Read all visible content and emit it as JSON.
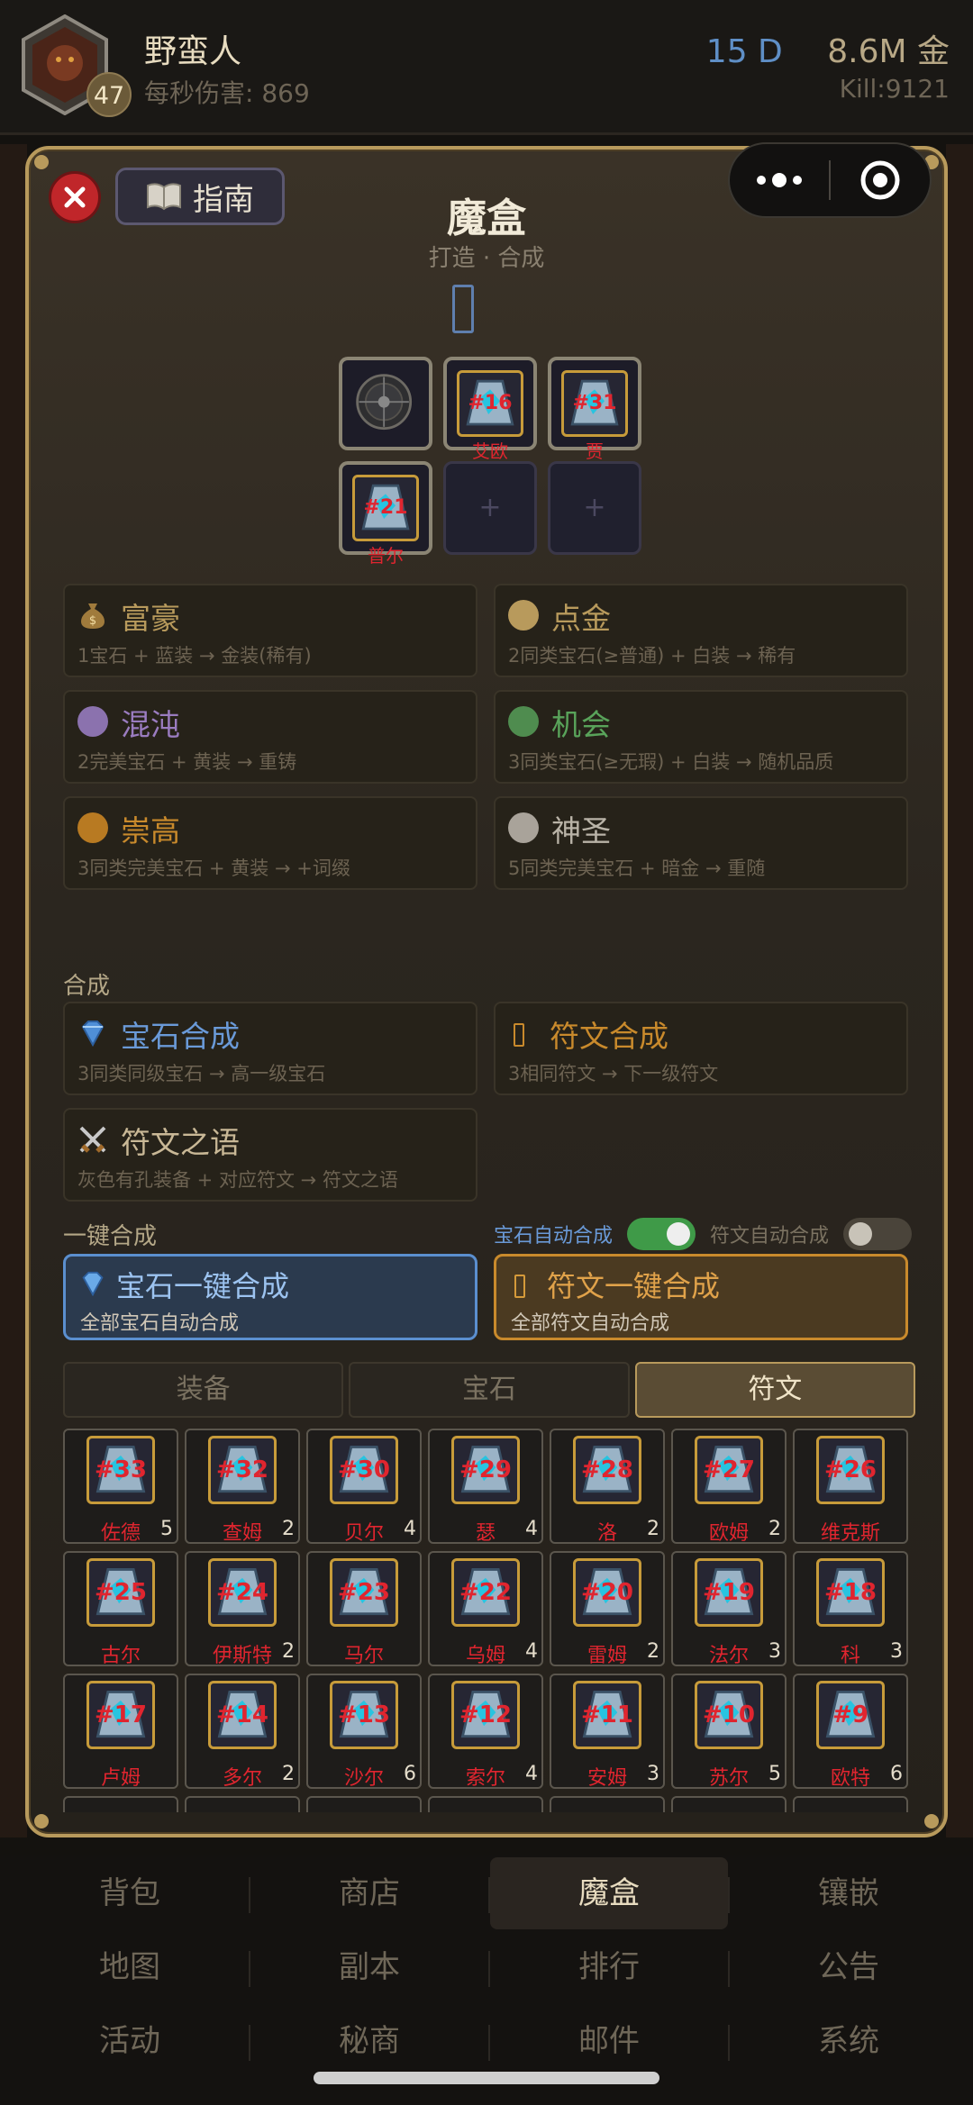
{
  "header": {
    "player_name": "野蛮人",
    "level": "47",
    "dps_text": "每秒伤害: 869",
    "days": "15 D",
    "gold": "8.6M 金",
    "kill": "Kill:9121"
  },
  "modal": {
    "title": "魔盒",
    "subtitle": "打造 · 合成",
    "guide_label": "指南",
    "slots": [
      {
        "type": "shield"
      },
      {
        "type": "rune",
        "num": "#16",
        "name": "艾欧"
      },
      {
        "type": "rune",
        "num": "#31",
        "name": "贾"
      },
      {
        "type": "rune",
        "num": "#21",
        "name": "普尔"
      },
      {
        "type": "empty",
        "plus": "+"
      },
      {
        "type": "empty",
        "plus": "+"
      }
    ],
    "recipes": [
      {
        "title": "富豪",
        "desc": "1宝石 + 蓝装 → 金装(稀有)",
        "color": "#b89a5c",
        "icon": "money-bag-icon"
      },
      {
        "title": "点金",
        "desc": "2同类宝石(≥普通) + 白装 → 稀有",
        "color": "#b89a5c",
        "icon": "gold-dot-icon"
      },
      {
        "title": "混沌",
        "desc": "2完美宝石 + 黄装 → 重铸",
        "color": "#9a7cc0",
        "icon": "purple-dot-icon"
      },
      {
        "title": "机会",
        "desc": "3同类宝石(≥无瑕) + 白装 → 随机品质",
        "color": "#59a35a",
        "icon": "green-dot-icon"
      },
      {
        "title": "崇高",
        "desc": "3同类完美宝石 + 黄装 → +词缀",
        "color": "#c98a2c",
        "icon": "orange-dot-icon"
      },
      {
        "title": "神圣",
        "desc": "5同类完美宝石 + 暗金 → 重随",
        "color": "#b9b3a7",
        "icon": "grey-dot-icon"
      }
    ],
    "merge_section_label": "合成",
    "merge_cards": [
      {
        "title": "宝石合成",
        "desc": "3同类同级宝石 → 高一级宝石",
        "color": "#6a9ad8",
        "icon": "gem-icon"
      },
      {
        "title": "符文合成",
        "desc": "3相同符文 → 下一级符文",
        "color": "#c98a2c",
        "icon": "rune-icon"
      },
      {
        "title": "符文之语",
        "desc": "灰色有孔装备 + 对应符文 → 符文之语",
        "color": "#c9b896",
        "icon": "crossed-swords-icon"
      }
    ],
    "one_click_label": "一键合成",
    "gem_auto_label": "宝石自动合成",
    "rune_auto_label": "符文自动合成",
    "gem_auto_on": true,
    "rune_auto_on": false,
    "gem_one_click": {
      "title": "宝石一键合成",
      "sub": "全部宝石自动合成"
    },
    "rune_one_click": {
      "title": "符文一键合成",
      "sub": "全部符文自动合成"
    },
    "tabs": [
      "装备",
      "宝石",
      "符文"
    ],
    "active_tab": 2,
    "runes": [
      {
        "num": "#33",
        "name": "佐德",
        "count": "5"
      },
      {
        "num": "#32",
        "name": "查姆",
        "count": "2"
      },
      {
        "num": "#30",
        "name": "贝尔",
        "count": "4"
      },
      {
        "num": "#29",
        "name": "瑟",
        "count": "4"
      },
      {
        "num": "#28",
        "name": "洛",
        "count": "2"
      },
      {
        "num": "#27",
        "name": "欧姆",
        "count": "2"
      },
      {
        "num": "#26",
        "name": "维克斯",
        "count": ""
      },
      {
        "num": "#25",
        "name": "古尔",
        "count": ""
      },
      {
        "num": "#24",
        "name": "伊斯特",
        "count": "2"
      },
      {
        "num": "#23",
        "name": "马尔",
        "count": ""
      },
      {
        "num": "#22",
        "name": "乌姆",
        "count": "4"
      },
      {
        "num": "#20",
        "name": "雷姆",
        "count": "2"
      },
      {
        "num": "#19",
        "name": "法尔",
        "count": "3"
      },
      {
        "num": "#18",
        "name": "科",
        "count": "3"
      },
      {
        "num": "#17",
        "name": "卢姆",
        "count": ""
      },
      {
        "num": "#14",
        "name": "多尔",
        "count": "2"
      },
      {
        "num": "#13",
        "name": "沙尔",
        "count": "6"
      },
      {
        "num": "#12",
        "name": "索尔",
        "count": "4"
      },
      {
        "num": "#11",
        "name": "安姆",
        "count": "3"
      },
      {
        "num": "#10",
        "name": "苏尔",
        "count": "5"
      },
      {
        "num": "#9",
        "name": "欧特",
        "count": "6"
      }
    ]
  },
  "nav": [
    [
      "背包",
      "商店",
      "魔盒",
      "镶嵌"
    ],
    [
      "地图",
      "副本",
      "排行",
      "公告"
    ],
    [
      "活动",
      "秘商",
      "邮件",
      "系统"
    ]
  ],
  "nav_active": "魔盒"
}
